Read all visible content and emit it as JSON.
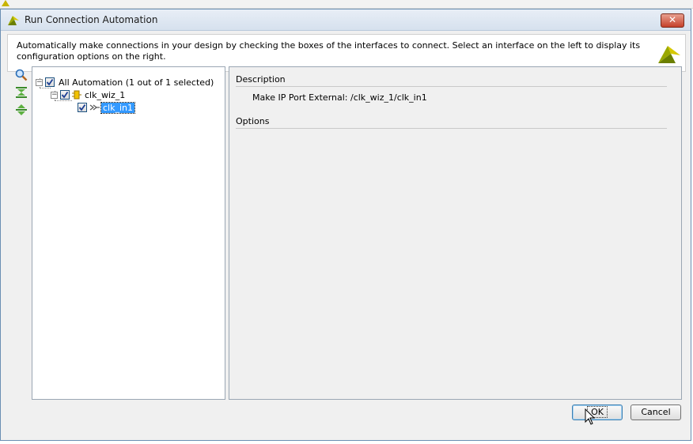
{
  "window": {
    "title": "Run Connection Automation",
    "close_label": "✕"
  },
  "banner": {
    "text": "Automatically make connections in your design by checking the boxes of the interfaces to connect. Select an interface on the left to display its configuration options on the right."
  },
  "toolbar": {
    "icons": [
      "search-icon",
      "collapse-all-icon",
      "expand-all-icon"
    ]
  },
  "tree": {
    "root": {
      "label": "All Automation (1 out of 1 selected)",
      "checked": true,
      "expanded": true
    },
    "ip": {
      "label": "clk_wiz_1",
      "checked": true,
      "expanded": true
    },
    "port": {
      "label": "clk_in1",
      "checked": true,
      "selected": true
    }
  },
  "details": {
    "description_header": "Description",
    "description_text": "Make IP Port External: /clk_wiz_1/clk_in1",
    "options_header": "Options"
  },
  "buttons": {
    "ok": "OK",
    "cancel": "Cancel"
  },
  "colors": {
    "selection": "#3399ff",
    "xilinx_logo": "#c8c800"
  }
}
